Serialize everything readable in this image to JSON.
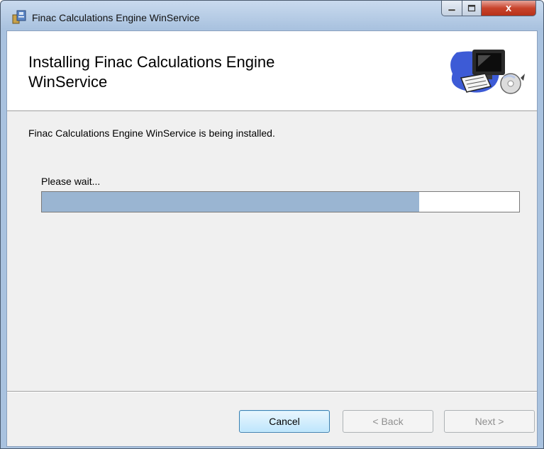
{
  "window": {
    "title": "Finac Calculations Engine WinService",
    "close_label": "x"
  },
  "header": {
    "title": "Installing Finac Calculations Engine WinService"
  },
  "body": {
    "status_message": "Finac Calculations Engine WinService is being installed.",
    "wait_label": "Please wait...",
    "progress_fraction": 0.79
  },
  "buttons": {
    "cancel": "Cancel",
    "back": "< Back",
    "next": "Next >"
  },
  "icons": [
    "installer-app-icon",
    "minimize-icon",
    "maximize-icon",
    "close-icon",
    "computer-setup-icon"
  ],
  "colors": {
    "progress_fill": "#9ab5d2",
    "close_button": "#c8442c"
  }
}
